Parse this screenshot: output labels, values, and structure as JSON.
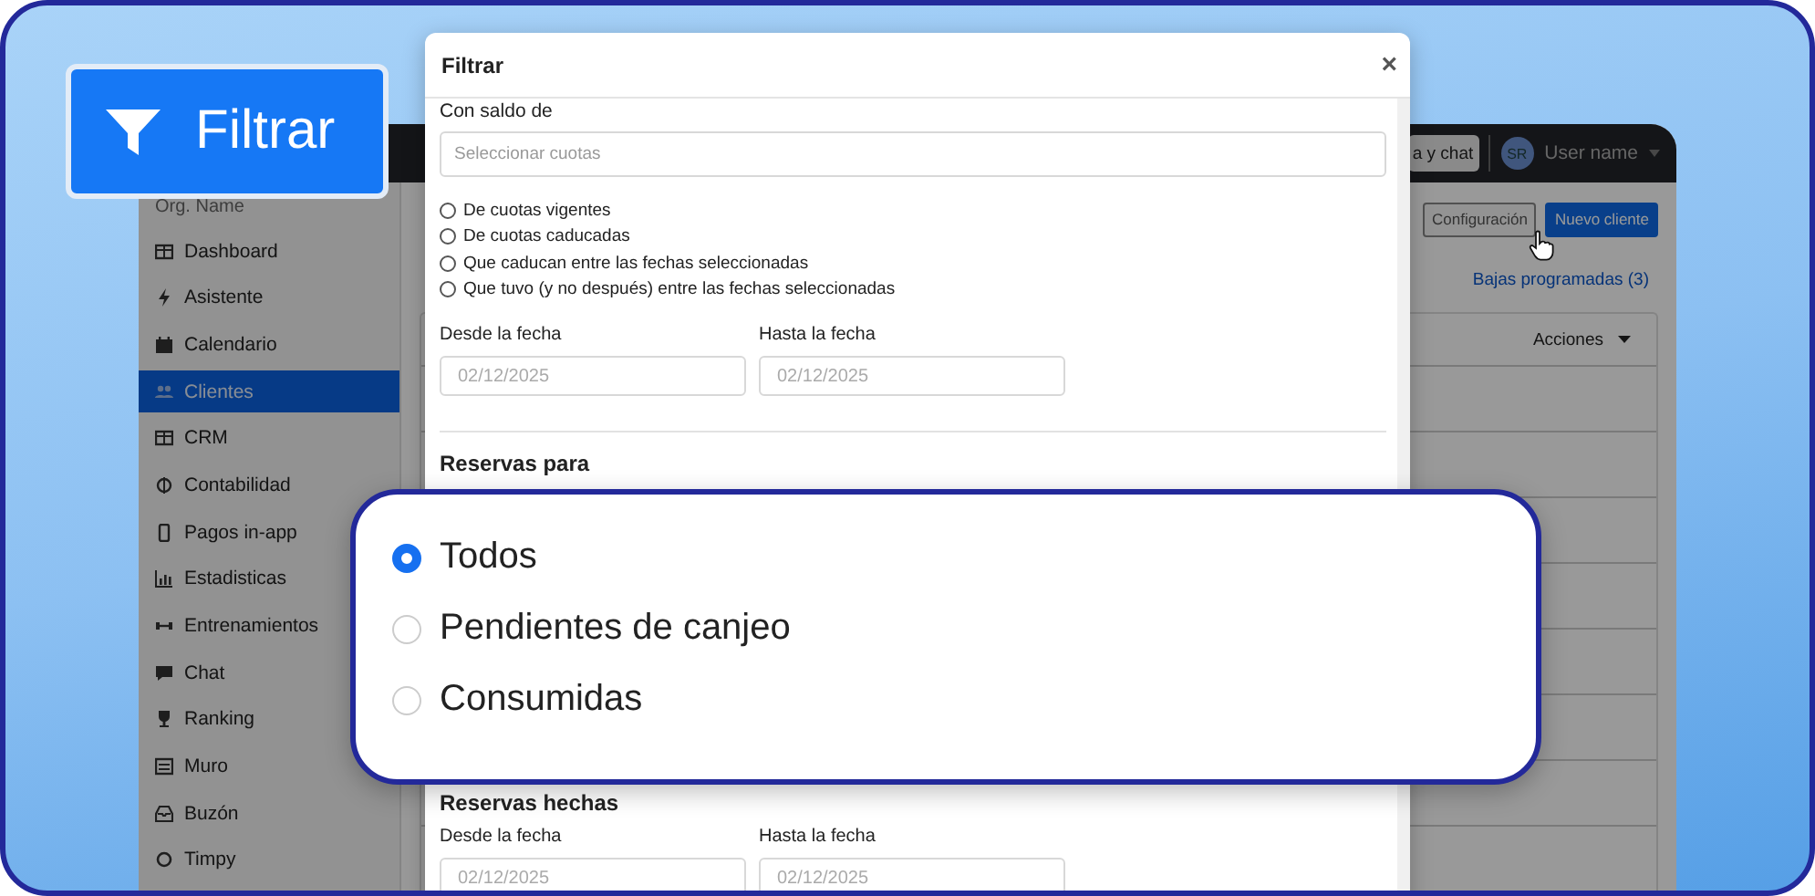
{
  "callout_button": {
    "label": "Filtrar"
  },
  "app": {
    "topbar": {
      "button": "a y chat",
      "avatar": "SR",
      "user": "User name"
    },
    "sidebar": {
      "org": "Org. Name",
      "items": [
        {
          "label": "Dashboard",
          "selected": false
        },
        {
          "label": "Asistente",
          "selected": false
        },
        {
          "label": "Calendario",
          "selected": false
        },
        {
          "label": "Clientes",
          "selected": true
        },
        {
          "label": "CRM",
          "selected": false
        },
        {
          "label": "Contabilidad",
          "selected": false
        },
        {
          "label": "Pagos in-app",
          "selected": false
        },
        {
          "label": "Estadisticas",
          "selected": false
        },
        {
          "label": "Entrenamientos",
          "selected": false
        },
        {
          "label": "Chat",
          "selected": false
        },
        {
          "label": "Ranking",
          "selected": false
        },
        {
          "label": "Muro",
          "selected": false
        },
        {
          "label": "Buzón",
          "selected": false
        },
        {
          "label": "Timpy",
          "selected": false
        }
      ]
    },
    "buttons": [
      {
        "label": "Configuración",
        "kind": "secondary"
      },
      {
        "label": "Nuevo cliente",
        "kind": "primary"
      }
    ],
    "link": "Bajas programadas (3)",
    "table": {
      "actions": "Acciones"
    }
  },
  "modal": {
    "title": "Filtrar",
    "close": "×",
    "balance_label": "Con saldo de",
    "balance_placeholder": "Seleccionar cuotas",
    "balance_options": [
      {
        "label": "De cuotas vigentes",
        "selected": false
      },
      {
        "label": "De cuotas caducadas",
        "selected": false
      },
      {
        "label": "Que caducan entre las fechas seleccionadas",
        "selected": false
      },
      {
        "label": "Que tuvo (y no después) entre las fechas seleccionadas",
        "selected": false
      }
    ],
    "dates_1": {
      "from_label": "Desde la fecha",
      "from_value": "02/12/2025",
      "to_label": "Hasta la fecha",
      "to_value": "02/12/2025"
    },
    "bookings_for": "Reservas para",
    "bookings_made": "Reservas hechas",
    "dates_2": {
      "from_label": "Desde la fecha",
      "from_value": "02/12/2025",
      "to_label": "Hasta la fecha",
      "to_value": "02/12/2025"
    }
  },
  "zoom_panel": {
    "options": [
      {
        "label": "Todos",
        "selected": true
      },
      {
        "label": "Pendientes de canjeo",
        "selected": false
      },
      {
        "label": "Consumidas",
        "selected": false
      }
    ]
  }
}
